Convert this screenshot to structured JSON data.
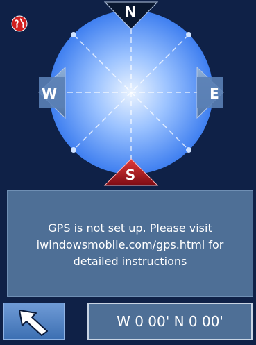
{
  "compass": {
    "north": "N",
    "south": "S",
    "west": "W",
    "east": "E"
  },
  "status": {
    "lines": [
      "GPS is not set up. Please visit",
      "iwindowsmobile.com/gps.html for",
      "detailed instructions"
    ]
  },
  "footer": {
    "coordinates": "W 0 00' N 0 00'"
  },
  "icons": {
    "app": "globe-icon",
    "back": "arrow-up-left-icon"
  },
  "colors": {
    "background": "#0f2147",
    "panel": "#4e6f96",
    "south_marker": "#c8202a"
  }
}
